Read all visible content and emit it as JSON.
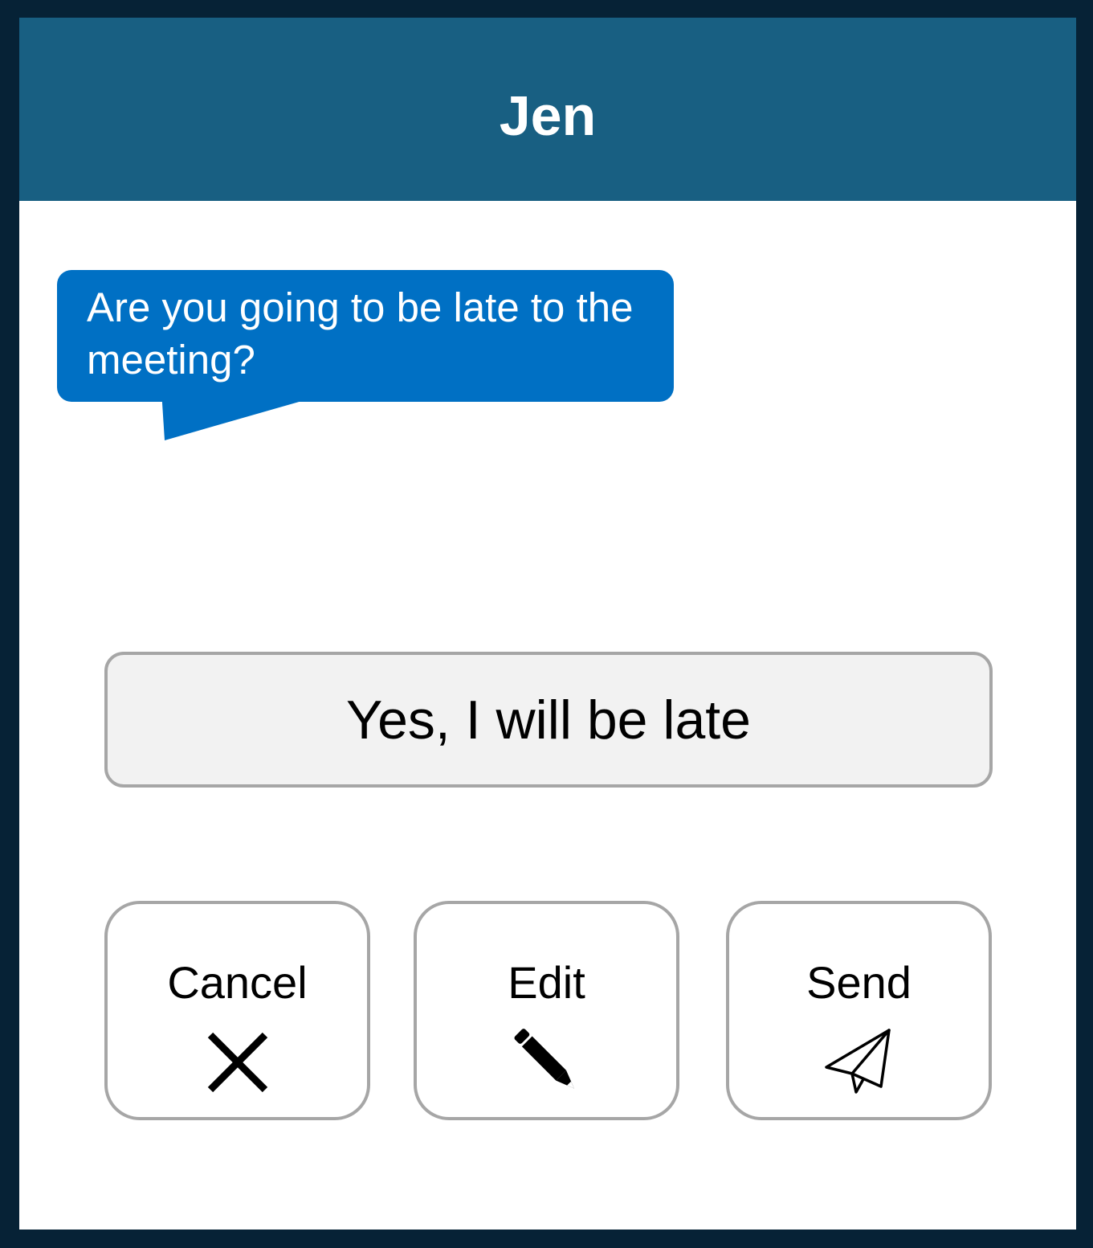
{
  "header": {
    "title": "Jen"
  },
  "incoming_message": {
    "text": "Are you going to be late to the meeting?"
  },
  "suggested_reply": {
    "text": "Yes, I will be late"
  },
  "actions": [
    {
      "label": "Cancel",
      "icon": "close-icon"
    },
    {
      "label": "Edit",
      "icon": "pencil-icon"
    },
    {
      "label": "Send",
      "icon": "paper-plane-icon"
    }
  ],
  "colors": {
    "header_bg": "#185f82",
    "bubble_bg": "#0070c4",
    "frame": "#062236",
    "button_border": "#a6a6a6",
    "reply_bg": "#f2f2f2"
  }
}
